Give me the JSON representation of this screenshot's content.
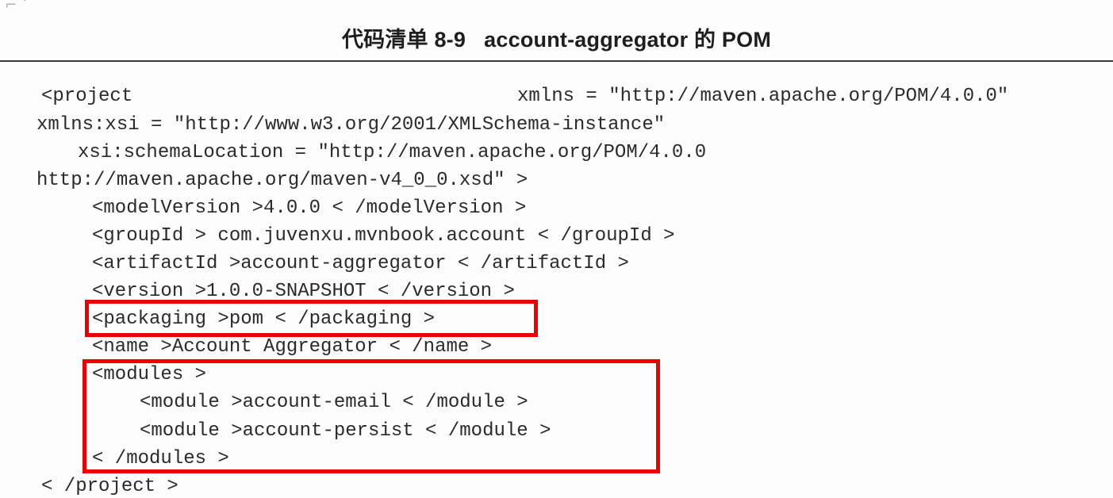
{
  "caption": "代码清单 8-9   account-aggregator 的 POM",
  "code": {
    "lines": [
      "<project",
      "xmlns = \"http://maven.apache.org/POM/4.0.0\"",
      "xmlns:xsi = \"http://www.w3.org/2001/XMLSchema-instance\"",
      "xsi:schemaLocation = \"http://maven.apache.org/POM/4.0.0",
      "http://maven.apache.org/maven-v4_0_0.xsd\" >",
      "<modelVersion >4.0.0 < /modelVersion >",
      "<groupId > com.juvenxu.mvnbook.account < /groupId >",
      "<artifactId >account-aggregator < /artifactId >",
      "<version >1.0.0-SNAPSHOT < /version >",
      "<packaging >pom < /packaging >",
      "<name >Account Aggregator < /name >",
      "<modules >",
      "<module >account-email < /module >",
      "<module >account-persist < /module >",
      "< /modules >",
      "< /project >"
    ]
  },
  "colors": {
    "highlight": "#ee0000",
    "text": "#2a2a2a"
  }
}
